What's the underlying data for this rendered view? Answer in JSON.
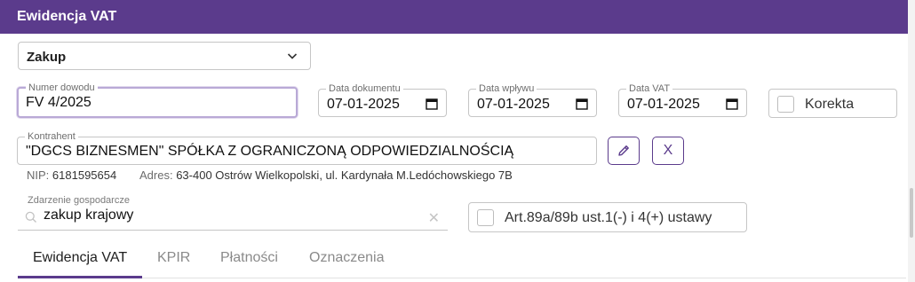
{
  "header": {
    "title": "Ewidencja VAT"
  },
  "type_select": {
    "value": "Zakup"
  },
  "doc_number": {
    "label": "Numer dowodu",
    "value": "FV 4/2025"
  },
  "doc_date": {
    "label": "Data dokumentu",
    "value": "07-01-2025"
  },
  "inflow_date": {
    "label": "Data wpływu",
    "value": "07-01-2025"
  },
  "vat_date": {
    "label": "Data VAT",
    "value": "07-01-2025"
  },
  "correction": {
    "label": "Korekta",
    "checked": false
  },
  "contractor": {
    "label": "Kontrahent",
    "value": "\"DGCS BIZNESMEN\" SPÓŁKA Z OGRANICZONĄ ODPOWIEDZIALNOŚCIĄ",
    "nip_label": "NIP:",
    "nip": "6181595654",
    "address_label": "Adres:",
    "address": "63-400 Ostrów Wielkopolski, ul. Kardynała M.Ledóchowskiego 7B",
    "edit_icon": "pencil-icon",
    "clear_label": "X"
  },
  "economic_event": {
    "label": "Zdarzenie gospodarcze",
    "value": "zakup krajowy",
    "clear": "✕"
  },
  "art89": {
    "label": "Art.89a/89b ust.1(-) i 4(+) ustawy",
    "checked": false
  },
  "tabs": [
    {
      "label": "Ewidencja VAT",
      "active": true
    },
    {
      "label": "KPIR",
      "active": false
    },
    {
      "label": "Płatności",
      "active": false
    },
    {
      "label": "Oznaczenia",
      "active": false
    }
  ],
  "colors": {
    "accent": "#5b3b8c",
    "border": "#c6c6c6",
    "focus": "#b9a9d6"
  }
}
